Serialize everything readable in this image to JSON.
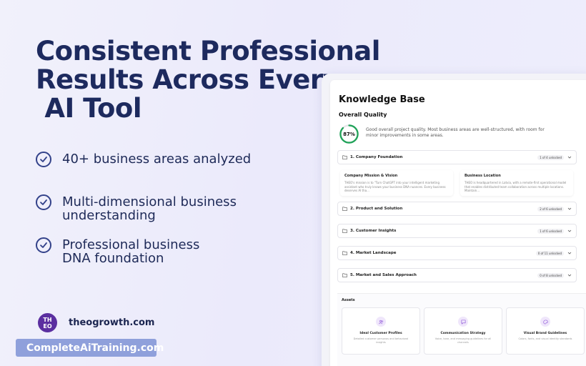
{
  "headline": {
    "line1": "Consistent Professional",
    "line2": "Results Across Every",
    "line3": " AI Tool"
  },
  "features": [
    {
      "line1": "40+ business areas analyzed",
      "line2": ""
    },
    {
      "line1": "Multi-dimensional business",
      "line2": "understanding"
    },
    {
      "line1": "Professional business",
      "line2": "DNA foundation"
    }
  ],
  "brand": {
    "logo_text_top": "TH",
    "logo_text_bottom": "EO",
    "domain": "theogrowth.com"
  },
  "watermark": {
    "text": "CompleteAiTraining.com"
  },
  "app": {
    "title": "Knowledge Base",
    "overall_quality": {
      "heading": "Overall Quality",
      "percent_label": "87%",
      "percent_value": 87,
      "description": "Good overall project quality. Most business areas are well-structured, with room for minor improvements in some areas."
    },
    "sections": [
      {
        "label": "1. Company Foundation",
        "badge": "1 of 4 unlocked"
      },
      {
        "label": "2. Product and Solution",
        "badge": "2 of 6 unlocked"
      },
      {
        "label": "3. Customer Insights",
        "badge": "1 of 6 unlocked"
      },
      {
        "label": "4. Market Landscape",
        "badge": "0 of 11 unlocked"
      },
      {
        "label": "5. Market and Sales Approach",
        "badge": "0 of 8 unlocked"
      }
    ],
    "subcards": [
      {
        "title": "Company Mission & Vision",
        "desc": "THEO's mission is to \"Turn ChatGPT into your intelligent marketing assistant who truly knows your business DNA nuances. Every business deserves AI tha..."
      },
      {
        "title": "Business Location",
        "desc": "THEO is headquartered in Latvia, with a remote-first operational model that enables distributed team collaboration across multiple locations. Maintain..."
      }
    ],
    "assets": {
      "heading": "Assets",
      "items": [
        {
          "title": "Ideal Customer Profiles",
          "desc": "Detailed customer personas and behavioral insights",
          "icon": "users-icon"
        },
        {
          "title": "Communication Strategy",
          "desc": "Voice, tone, and messaging guidelines for all channels",
          "icon": "chat-icon"
        },
        {
          "title": "Visual Brand Guidelines",
          "desc": "Colors, fonts, and visual identity standards",
          "icon": "palette-icon"
        }
      ]
    }
  },
  "colors": {
    "headline": "#1d2a5e",
    "accent_green": "#22a35a",
    "logo_purple": "#5b2fa0",
    "watermark_bg": "#8fa0db",
    "asset_icon_purple": "#8a4fd6"
  }
}
